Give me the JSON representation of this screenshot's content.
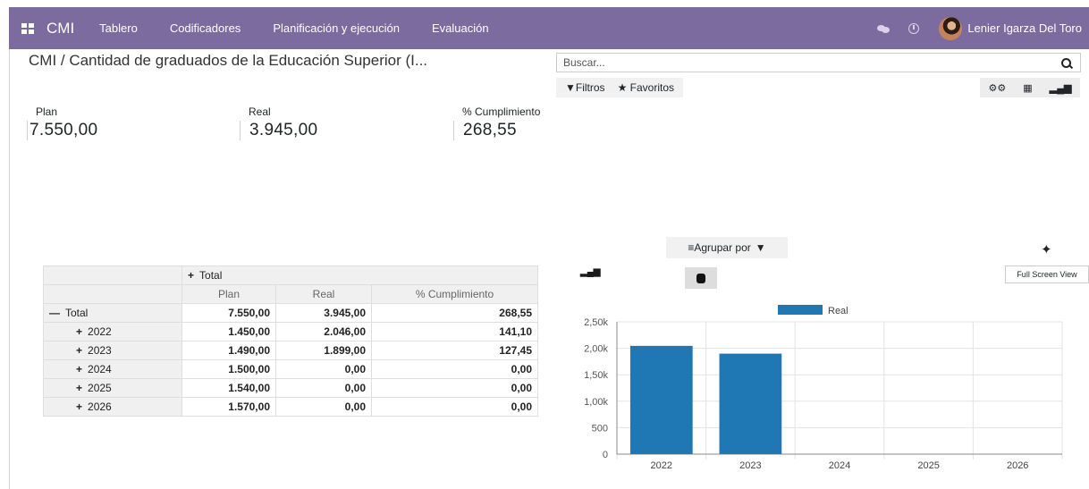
{
  "topbar": {
    "brand": "CMI",
    "menu": [
      "Tablero",
      "Codificadores",
      "Planificación y ejecución",
      "Evaluación"
    ],
    "user": "Lenier Igarza Del Toro"
  },
  "breadcrumb": "CMI / Cantidad de graduados de la Educación Superior (I...",
  "search": {
    "placeholder": "Buscar..."
  },
  "filters": {
    "filtros": "Filtros",
    "favoritos": "Favoritos"
  },
  "kpis": [
    {
      "label": "Plan",
      "value": "7.550,00"
    },
    {
      "label": "Real",
      "value": "3.945,00"
    },
    {
      "label": "% Cumplimiento",
      "value": "268,55"
    }
  ],
  "pivot": {
    "col_header": "Total",
    "measures": [
      "Plan",
      "Real",
      "% Cumplimiento"
    ],
    "total_row": {
      "label": "Total",
      "plan": "7.550,00",
      "real": "3.945,00",
      "pct": "268,55"
    },
    "rows": [
      {
        "label": "2022",
        "plan": "1.450,00",
        "real": "2.046,00",
        "pct": "141,10"
      },
      {
        "label": "2023",
        "plan": "1.490,00",
        "real": "1.899,00",
        "pct": "127,45"
      },
      {
        "label": "2024",
        "plan": "1.500,00",
        "real": "0,00",
        "pct": "0,00"
      },
      {
        "label": "2025",
        "plan": "1.540,00",
        "real": "0,00",
        "pct": "0,00"
      },
      {
        "label": "2026",
        "plan": "1.570,00",
        "real": "0,00",
        "pct": "0,00"
      }
    ]
  },
  "groupby_label": "Agrupar por",
  "fullscreen_tip": "Full Screen View",
  "chart_data": {
    "type": "bar",
    "categories": [
      "2022",
      "2023",
      "2024",
      "2025",
      "2026"
    ],
    "series": [
      {
        "name": "Real",
        "values": [
          2046,
          1899,
          0,
          0,
          0
        ],
        "color": "#1f77b4"
      }
    ],
    "ylim": [
      0,
      2500
    ],
    "yticks": [
      "0",
      "500",
      "1,00k",
      "1,50k",
      "2,00k",
      "2,50k"
    ],
    "legend": "top",
    "grid": true
  },
  "colors": {
    "topbar": "#7c6b9e",
    "bar": "#1f77b4"
  }
}
